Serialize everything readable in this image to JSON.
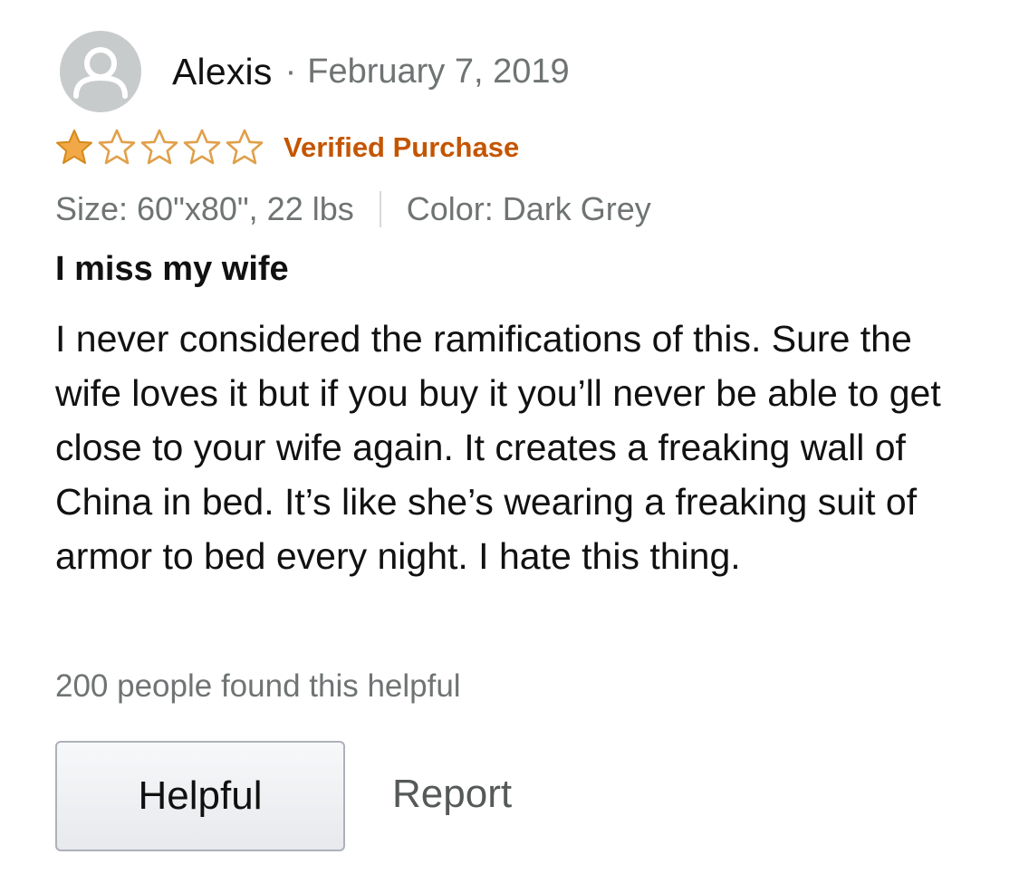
{
  "review": {
    "author": "Alexis",
    "separator": "·",
    "date": "February 7, 2019",
    "avatar_icon": "default-user-icon",
    "rating": {
      "value": 1,
      "max": 5,
      "filled_color": "#f3a847",
      "empty_color": "#e0a04a"
    },
    "verified_label": "Verified Purchase",
    "verified_color": "#c45500",
    "variant": {
      "size": "Size: 60\"x80\", 22 lbs",
      "color": "Color: Dark Grey"
    },
    "title": "I miss my wife",
    "body": "I never considered the ramifications of this. Sure the wife loves it but if you buy it you’ll never be able to get close to your wife again. It creates a freaking wall of China in bed. It’s like she’s wearing a freaking suit of armor to bed every night. I hate this thing.",
    "helpful_count_text": "200 people found this helpful",
    "actions": {
      "helpful_label": "Helpful",
      "report_label": "Report"
    }
  }
}
